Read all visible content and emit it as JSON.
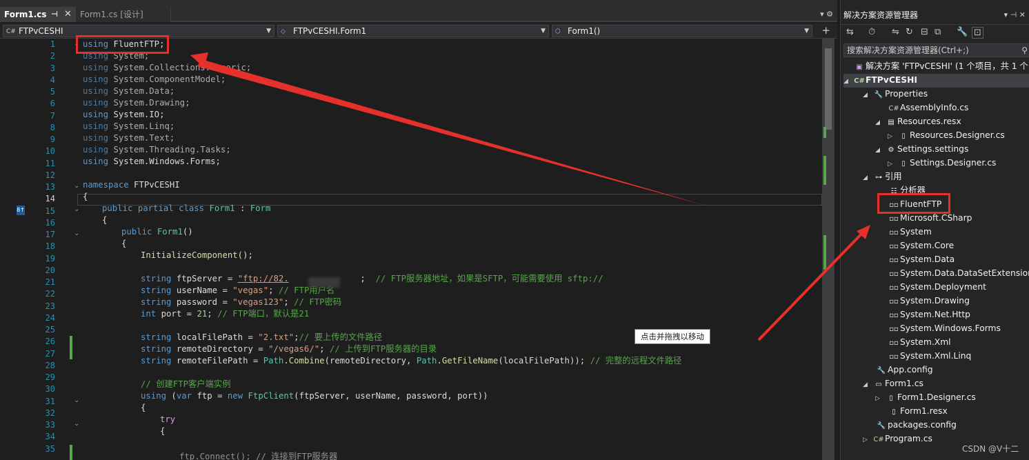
{
  "tabs": [
    {
      "label": "Form1.cs",
      "active": true
    },
    {
      "label": "Form1.cs [设计]",
      "active": false
    }
  ],
  "nav": {
    "project": "FTPvCESHI",
    "class": "FTPvCESHI.Form1",
    "member": "Form1()"
  },
  "line_numbers": [
    "1",
    "2",
    "3",
    "4",
    "5",
    "6",
    "7",
    "8",
    "9",
    "10",
    "11",
    "12",
    "13",
    "14",
    "15",
    "16",
    "17",
    "18",
    "19",
    "20",
    "21",
    "22",
    "23",
    "24",
    "25",
    "26",
    "27",
    "28",
    "29",
    "30",
    "31",
    "32",
    "33",
    "34",
    "35"
  ],
  "code": {
    "l1": "FluentFTP;",
    "l2": "System;",
    "l3": "System.Collections.Generic;",
    "l4": "System.ComponentModel;",
    "l5": "System.Data;",
    "l6": "System.Drawing;",
    "l7": "System.IO;",
    "l8": "System.Linq;",
    "l9": "System.Text;",
    "l10": "System.Threading.Tasks;",
    "l11": "System.Windows.Forms;",
    "kw_using": "using",
    "kw_namespace": "namespace",
    "ns": "FTPvCESHI",
    "brace_open": "{",
    "kw_public": "public",
    "kw_partial": "partial",
    "kw_class": "class",
    "cls": "Form1",
    "colon": ":",
    "base": "Form",
    "ctor": "Form1",
    "parens": "()",
    "init": "InitializeComponent",
    "init_end": "();",
    "kw_string": "string",
    "kw_int": "int",
    "v_server": "ftpServer",
    "s_server": "\"ftp://82.",
    "c_server": "// FTP服务器地址，如果是SFTP，可能需要使用 sftp://",
    "v_user": "userName",
    "s_user": "\"vegas\"",
    "c_user": "// FTP用户名",
    "v_pass": "password",
    "s_pass": "\"vegas123\"",
    "c_pass": "// FTP密码",
    "v_port": "port",
    "n_port": "21",
    "c_port": "// FTP端口，默认是21",
    "v_local": "localFilePath",
    "s_local": "\"2.txt\"",
    "c_local": "// 要上传的文件路径",
    "v_rdir": "remoteDirectory",
    "s_rdir": "\"/vegas6/\"",
    "c_rdir": "// 上传到FTP服务器的目录",
    "v_rpath": "remoteFilePath",
    "path": "Path",
    "combine": "Combine",
    "getname": "GetFileName",
    "c_rpath": "// 完整的远程文件路径",
    "c_create": "// 创建FTP客户端实例",
    "kw_var": "var",
    "v_ftp": "ftp",
    "kw_new": "new",
    "ftpclient": "FtpClient",
    "kw_try": "try",
    "l35": "ftp.Connect(); // 连接到FTP服务器"
  },
  "tooltip": "点击并拖拽以移动",
  "solution": {
    "title": "解决方案资源管理器",
    "search_placeholder": "搜索解决方案资源管理器(Ctrl+;)",
    "root": "解决方案 'FTPvCESHI' (1 个项目，共 1 个)",
    "items": [
      "FTPvCESHI",
      "Properties",
      "AssemblyInfo.cs",
      "Resources.resx",
      "Resources.Designer.cs",
      "Settings.settings",
      "Settings.Designer.cs",
      "引用",
      "分析器",
      "FluentFTP",
      "Microsoft.CSharp",
      "System",
      "System.Core",
      "System.Data",
      "System.Data.DataSetExtensions",
      "System.Deployment",
      "System.Drawing",
      "System.Net.Http",
      "System.Windows.Forms",
      "System.Xml",
      "System.Xml.Linq",
      "App.config",
      "Form1.cs",
      "Form1.Designer.cs",
      "Form1.resx",
      "packages.config",
      "Program.cs"
    ]
  },
  "watermark": "CSDN @V十二",
  "colors": {
    "annotation_red": "#e5302c",
    "keyword": "#569cd6",
    "type": "#4ec9b0",
    "string": "#d69d85",
    "comment": "#57a64a"
  }
}
